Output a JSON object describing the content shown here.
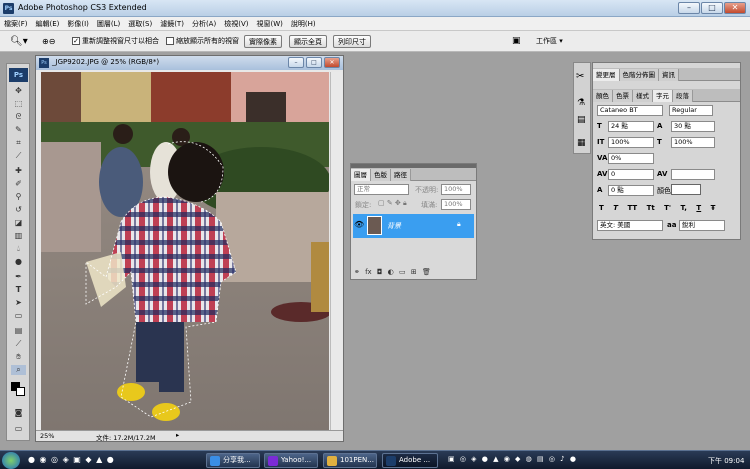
{
  "app": {
    "title": "Adobe Photoshop CS3 Extended",
    "icon": "ps-logo-icon"
  },
  "menu": [
    "檔案(F)",
    "編輯(E)",
    "影像(I)",
    "圖層(L)",
    "選取(S)",
    "濾鏡(T)",
    "分析(A)",
    "檢視(V)",
    "視窗(W)",
    "說明(H)"
  ],
  "options": {
    "resize_label": "重新調整視窗尺寸以相合",
    "zoom_all_label": "縮放顯示所有的視窗",
    "actual_pixels": "實際像素",
    "fit_screen": "顯示全頁",
    "print_size": "列印尺寸",
    "workspace": "工作區 ▾"
  },
  "document": {
    "title": "_JGP9202.JPG @ 25% (RGB/8*)",
    "zoom": "25%",
    "file_info": "文件: 17.2M/17.2M"
  },
  "layers_panel": {
    "tabs": [
      "圖層",
      "色版",
      "路徑"
    ],
    "blend_mode": "正常",
    "opacity_label": "不透明:",
    "opacity": "100%",
    "lock_label": "鎖定:",
    "fill_label": "填滿:",
    "fill": "100%",
    "layer_name": "背景"
  },
  "char_panel": {
    "top_tabs": [
      "變更層",
      "色階分佈圖",
      "資訊"
    ],
    "tabs": [
      "顏色",
      "色票",
      "樣式",
      "字元",
      "段落"
    ],
    "font": "Cataneo BT",
    "style": "Regular",
    "size": "24 點",
    "leading": "30 點",
    "vscale": "100%",
    "hscale": "100%",
    "tracking": "0%",
    "kerning": "0",
    "baseline": "0 點",
    "color_label": "顏色:",
    "type_buttons": [
      "T",
      "T",
      "TT",
      "Tt",
      "T'",
      "T,",
      "T",
      "Ŧ"
    ],
    "language": "英文: 美國",
    "antialias": "銳利"
  },
  "taskbar": {
    "items": [
      "分享我...",
      "Yahoo!...",
      "101PEN...",
      "Adobe ..."
    ],
    "clock": "下午 09:04"
  }
}
